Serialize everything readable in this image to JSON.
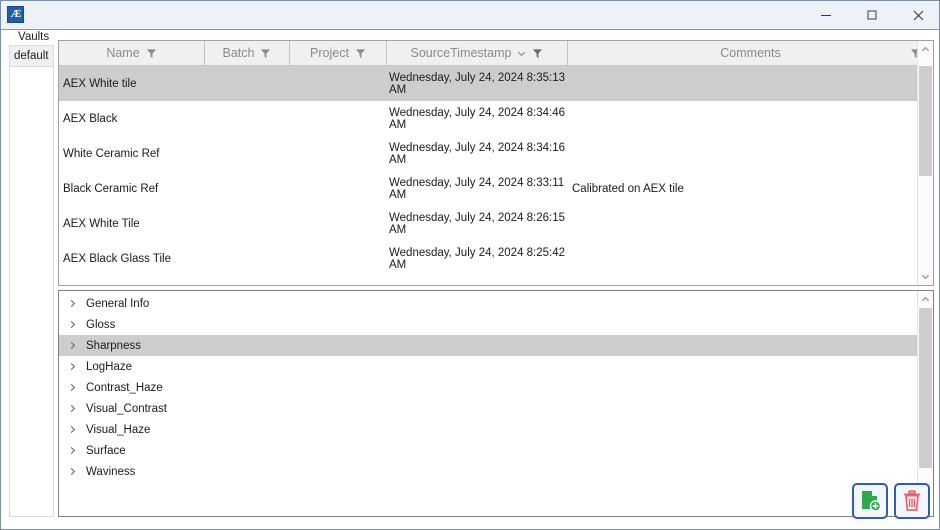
{
  "window": {
    "app_icon": "app-logo-icon",
    "app_icon_glyph": "Æ",
    "title": "",
    "controls": {
      "minimize": "minimize-button",
      "maximize": "maximize-button",
      "close": "close-button"
    }
  },
  "sidebar": {
    "tab_label": "Vaults",
    "items": [
      {
        "label": "default"
      }
    ]
  },
  "grid": {
    "columns": [
      {
        "label": "Name",
        "has_filter": true,
        "has_sort": false
      },
      {
        "label": "Batch",
        "has_filter": true,
        "has_sort": false
      },
      {
        "label": "Project",
        "has_filter": true,
        "has_sort": false
      },
      {
        "label": "SourceTimestamp",
        "has_filter": true,
        "has_sort": true,
        "sort_dir": "desc"
      },
      {
        "label": "Comments",
        "has_filter": true,
        "has_sort": false
      }
    ],
    "rows": [
      {
        "name": "AEX White tile",
        "batch": "",
        "project": "",
        "timestamp": "Wednesday, July 24, 2024 8:35:13 AM",
        "comments": "",
        "selected": true
      },
      {
        "name": "AEX Black",
        "batch": "",
        "project": "",
        "timestamp": "Wednesday, July 24, 2024 8:34:46 AM",
        "comments": "",
        "selected": false
      },
      {
        "name": "White Ceramic Ref",
        "batch": "",
        "project": "",
        "timestamp": "Wednesday, July 24, 2024 8:34:16 AM",
        "comments": "",
        "selected": false
      },
      {
        "name": "Black Ceramic Ref",
        "batch": "",
        "project": "",
        "timestamp": "Wednesday, July 24, 2024 8:33:11 AM",
        "comments": "Calibrated on AEX tile",
        "selected": false
      },
      {
        "name": "AEX White Tile",
        "batch": "",
        "project": "",
        "timestamp": "Wednesday, July 24, 2024 8:26:15 AM",
        "comments": "",
        "selected": false
      },
      {
        "name": "AEX Black Glass Tile",
        "batch": "",
        "project": "",
        "timestamp": "Wednesday, July 24, 2024 8:25:42 AM",
        "comments": "",
        "selected": false
      }
    ]
  },
  "tree": {
    "nodes": [
      {
        "label": "General Info",
        "expanded": false,
        "selected": false
      },
      {
        "label": "Gloss",
        "expanded": false,
        "selected": false
      },
      {
        "label": "Sharpness",
        "expanded": false,
        "selected": true
      },
      {
        "label": "LogHaze",
        "expanded": false,
        "selected": false
      },
      {
        "label": "Contrast_Haze",
        "expanded": false,
        "selected": false
      },
      {
        "label": "Visual_Contrast",
        "expanded": false,
        "selected": false
      },
      {
        "label": "Visual_Haze",
        "expanded": false,
        "selected": false
      },
      {
        "label": "Surface",
        "expanded": false,
        "selected": false
      },
      {
        "label": "Waviness",
        "expanded": false,
        "selected": false
      }
    ]
  },
  "actions": {
    "add": {
      "icon": "add-document-icon",
      "label": ""
    },
    "delete": {
      "icon": "trash-icon",
      "label": ""
    }
  },
  "colors": {
    "titlebar_bg": "#edf1f8",
    "accent_border": "#2f5fa8",
    "selection": "#cdcdcd",
    "header_bg": "#f0f0f0",
    "header_text": "#8a8a8a",
    "add_icon": "#2fa84f",
    "delete_icon": "#e8616f"
  }
}
